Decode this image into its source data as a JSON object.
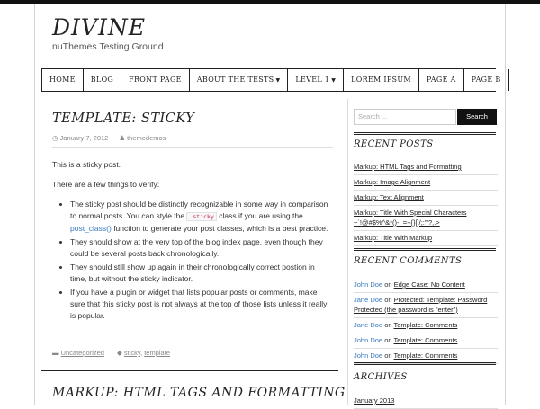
{
  "site": {
    "title": "DIVINE",
    "tagline": "nuThemes Testing Ground"
  },
  "nav": [
    {
      "label": "HOME",
      "dropdown": false
    },
    {
      "label": "BLOG",
      "dropdown": false
    },
    {
      "label": "FRONT PAGE",
      "dropdown": false
    },
    {
      "label": "ABOUT THE TESTS",
      "dropdown": true
    },
    {
      "label": "LEVEL 1",
      "dropdown": true
    },
    {
      "label": "LOREM IPSUM",
      "dropdown": false
    },
    {
      "label": "PAGE A",
      "dropdown": false
    },
    {
      "label": "PAGE B",
      "dropdown": false
    }
  ],
  "post": {
    "title": "TEMPLATE: STICKY",
    "date": "January 7, 2012",
    "author": "themedemos",
    "p1": "This is a sticky post.",
    "p2": "There are a few things to verify:",
    "bullet1_a": "The sticky post should be distinctly recognizable in some way in comparison to normal posts. You can style the ",
    "bullet1_code": ".sticky",
    "bullet1_b": " class if you are using the ",
    "bullet1_link": "post_class()",
    "bullet1_c": " function to generate your post classes, which is a best practice.",
    "bullet2": "They should show at the very top of the blog index page, even though they could be several posts back chronologically.",
    "bullet3": "They should still show up again in their chronologically correct postion in time, but without the sticky indicator.",
    "bullet4": "If you have a plugin or widget that lists popular posts or comments, make sure that this sticky post is not always at the top of those lists unless it really is popular.",
    "category": "Uncategorized",
    "tag1": "sticky",
    "tag2": "template"
  },
  "post2": {
    "title": "MARKUP: HTML TAGS AND FORMATTING"
  },
  "sidebar": {
    "search_placeholder": "Search ...",
    "search_button": "Search",
    "recent_posts_title": "RECENT POSTS",
    "recent_posts": [
      "Markup: HTML Tags and Formatting",
      "Markup: Image Alignment",
      "Markup: Text Alignment",
      "Markup: Title With Special Characters ~`!@#$%^&*()-_=+{}[]/;:'\"?,.>",
      "Markup: Title With Markup"
    ],
    "recent_comments_title": "RECENT COMMENTS",
    "recent_comments": [
      {
        "author": "John Doe",
        "on": "on",
        "post": "Edge Case: No Content"
      },
      {
        "author": "Jane Doe",
        "on": "on",
        "post": "Protected: Template: Password Protected (the password is \"enter\")"
      },
      {
        "author": "Jane Doe",
        "on": "on",
        "post": "Template: Comments"
      },
      {
        "author": "John Doe",
        "on": "on",
        "post": "Template: Comments"
      },
      {
        "author": "John Doe",
        "on": "on",
        "post": "Template: Comments"
      }
    ],
    "archives_title": "ARCHIVES",
    "archives": [
      "January 2013"
    ]
  },
  "colors": {
    "link": "#3a7bbf",
    "text": "#333333",
    "dark": "#111111"
  }
}
